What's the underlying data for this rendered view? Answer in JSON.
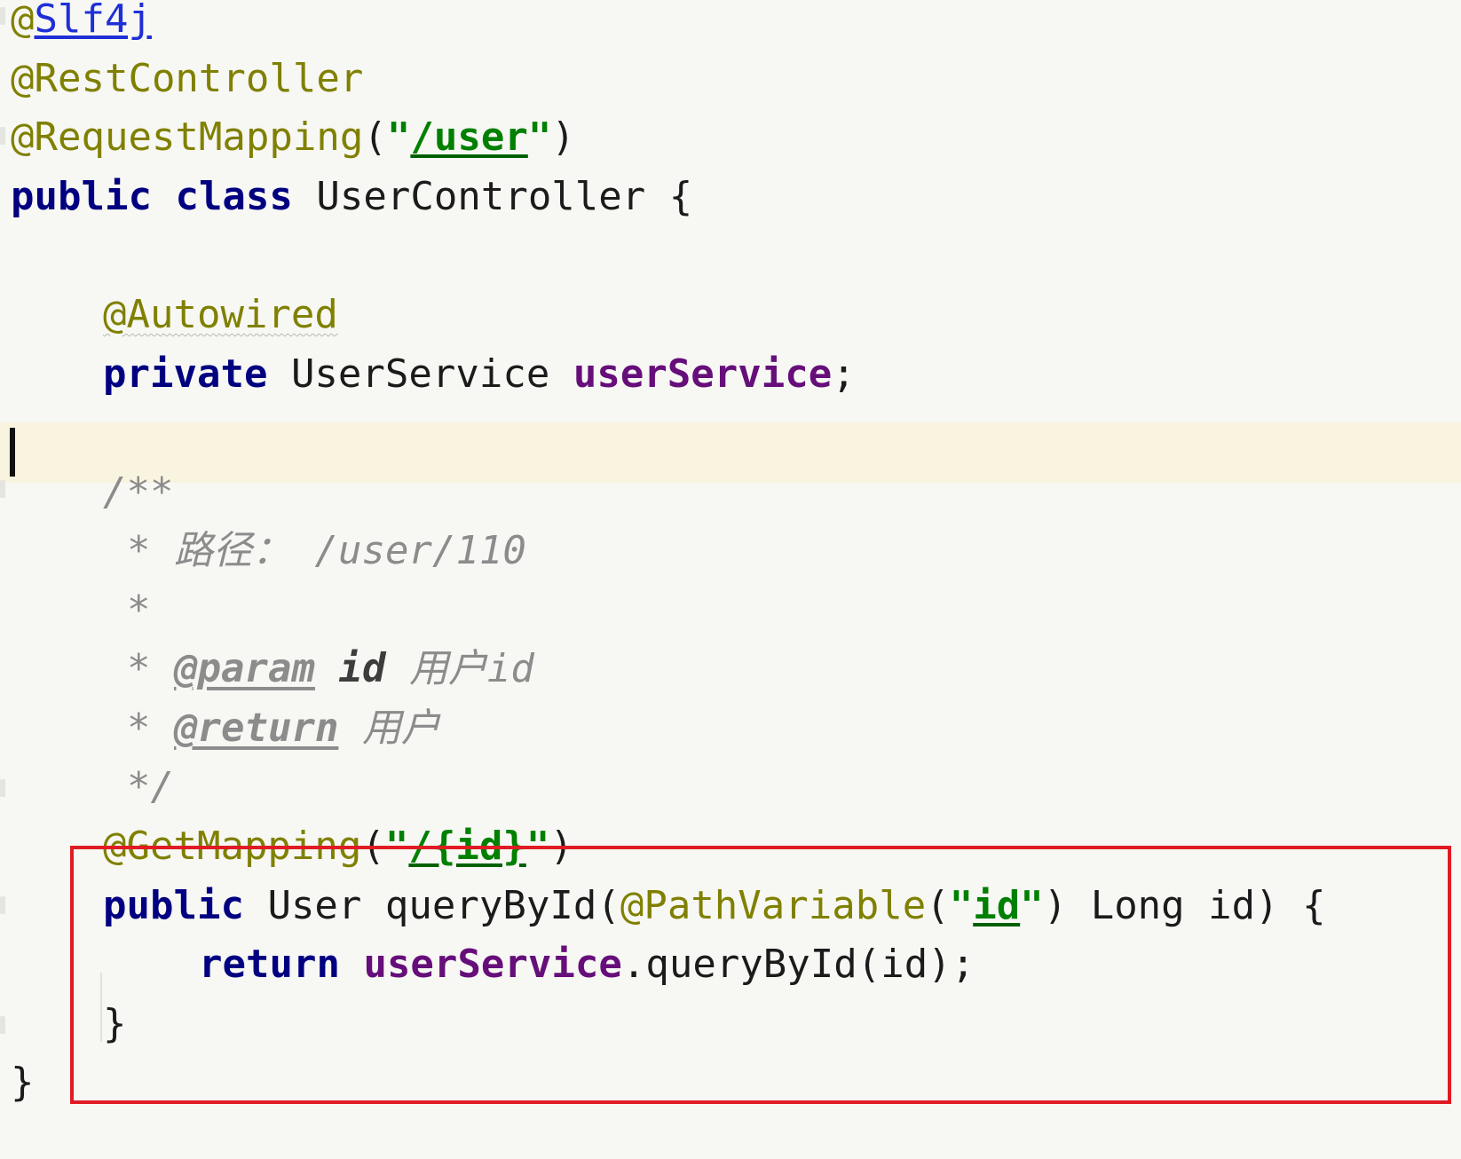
{
  "editor": {
    "language": "java",
    "colors": {
      "background": "#f7f7f4",
      "caret_line": "#f8f4df",
      "annotation": "#808000",
      "keyword": "#000080",
      "string": "#008000",
      "field": "#660e7a",
      "comment": "#8c8c8c",
      "highlight_border": "#e01b24"
    },
    "lines": {
      "l1": {
        "at": "@",
        "name": "Slf4j"
      },
      "l2": {
        "text": "@RestController"
      },
      "l3": {
        "ann": "@RequestMapping",
        "open": "(",
        "q1": "\"",
        "path": "/user",
        "q2": "\"",
        "close": ")"
      },
      "l4": {
        "kw1": "public",
        "kw2": "class",
        "name": "UserController",
        "brace": "{"
      },
      "l6": {
        "text": "@Autowired"
      },
      "l7": {
        "kw": "private",
        "type": "UserService",
        "field": "userService",
        "semi": ";"
      },
      "l9": {
        "text": "/**"
      },
      "l10": {
        "star": "*",
        "label": "路径：",
        "path": "/user/110"
      },
      "l11": {
        "star": "*"
      },
      "l12": {
        "star": "*",
        "tag": "@param",
        "param": "id",
        "desc": "用户id"
      },
      "l13": {
        "star": "*",
        "tag": "@return",
        "desc": "用户"
      },
      "l14": {
        "text": "*/"
      },
      "l15": {
        "ann": "@GetMapping",
        "open": "(",
        "q1": "\"",
        "path": "/{id}",
        "q2": "\"",
        "close": ")"
      },
      "l16": {
        "kw": "public",
        "type": "User",
        "method": "queryById",
        "open": "(",
        "ann": "@PathVariable",
        "aopen": "(",
        "q1": "\"",
        "val": "id",
        "q2": "\"",
        "aclose": ")",
        "ptype": "Long",
        "pname": "id",
        "close": ")",
        "brace": "{"
      },
      "l17": {
        "kw": "return",
        "field": "userService",
        "call": ".queryById(id);"
      },
      "l18": {
        "brace": "}"
      },
      "l19": {
        "brace": "}"
      }
    }
  }
}
